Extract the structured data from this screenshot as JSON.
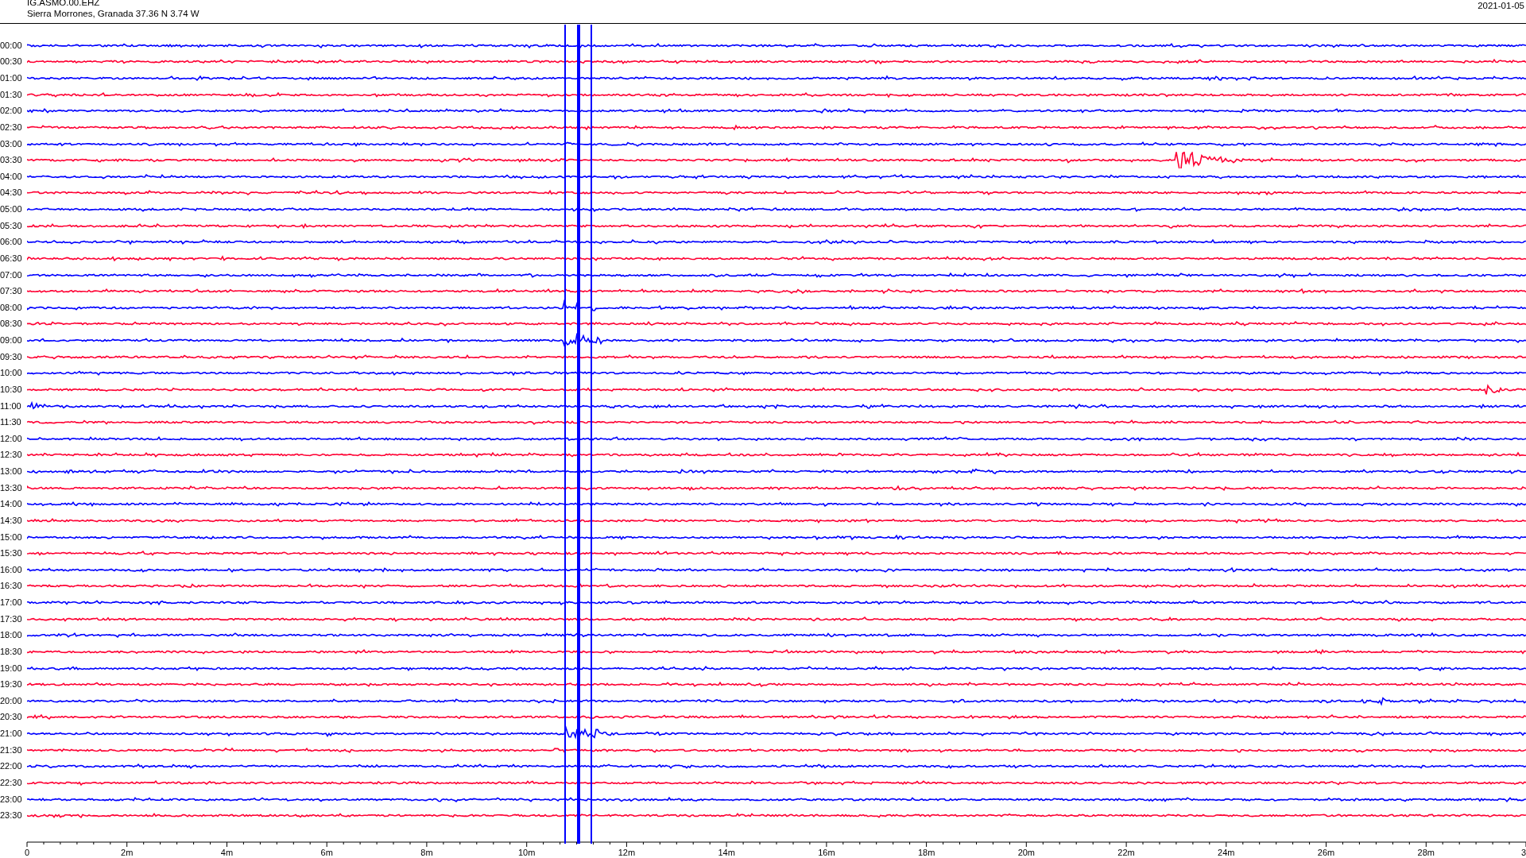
{
  "header": {
    "station": "IG.ASMO.00.EHZ",
    "location": "Sierra Morrones, Granada  37.36 N 3.74 W",
    "date": "2021-01-05"
  },
  "rows": [
    {
      "time": "00:00",
      "color": "#0000ff"
    },
    {
      "time": "00:30",
      "color": "#ff0033"
    },
    {
      "time": "01:00",
      "color": "#0000ff"
    },
    {
      "time": "01:30",
      "color": "#ff0033"
    },
    {
      "time": "02:00",
      "color": "#0000ff"
    },
    {
      "time": "02:30",
      "color": "#ff0033"
    },
    {
      "time": "03:00",
      "color": "#0000ff"
    },
    {
      "time": "03:30",
      "color": "#ff0033"
    },
    {
      "time": "04:00",
      "color": "#0000ff"
    },
    {
      "time": "04:30",
      "color": "#ff0033"
    },
    {
      "time": "05:00",
      "color": "#0000ff"
    },
    {
      "time": "05:30",
      "color": "#ff0033"
    },
    {
      "time": "06:00",
      "color": "#0000ff"
    },
    {
      "time": "06:30",
      "color": "#ff0033"
    },
    {
      "time": "07:00",
      "color": "#0000ff"
    },
    {
      "time": "07:30",
      "color": "#ff0033"
    },
    {
      "time": "08:00",
      "color": "#0000ff"
    },
    {
      "time": "08:30",
      "color": "#ff0033"
    },
    {
      "time": "09:00",
      "color": "#0000ff"
    },
    {
      "time": "09:30",
      "color": "#ff0033"
    },
    {
      "time": "10:00",
      "color": "#0000ff"
    },
    {
      "time": "10:30",
      "color": "#ff0033"
    },
    {
      "time": "11:00",
      "color": "#0000ff"
    },
    {
      "time": "11:30",
      "color": "#ff0033"
    },
    {
      "time": "12:00",
      "color": "#0000ff"
    },
    {
      "time": "12:30",
      "color": "#ff0033"
    },
    {
      "time": "13:00",
      "color": "#0000ff"
    },
    {
      "time": "13:30",
      "color": "#ff0033"
    },
    {
      "time": "14:00",
      "color": "#0000ff"
    },
    {
      "time": "14:30",
      "color": "#ff0033"
    },
    {
      "time": "15:00",
      "color": "#0000ff"
    },
    {
      "time": "15:30",
      "color": "#ff0033"
    },
    {
      "time": "16:00",
      "color": "#0000ff"
    },
    {
      "time": "16:30",
      "color": "#ff0033"
    },
    {
      "time": "17:00",
      "color": "#0000ff"
    },
    {
      "time": "17:30",
      "color": "#ff0033"
    },
    {
      "time": "18:00",
      "color": "#0000ff"
    },
    {
      "time": "18:30",
      "color": "#ff0033"
    },
    {
      "time": "19:00",
      "color": "#0000ff"
    },
    {
      "time": "19:30",
      "color": "#ff0033"
    },
    {
      "time": "20:00",
      "color": "#0000ff"
    },
    {
      "time": "20:30",
      "color": "#ff0033"
    },
    {
      "time": "21:00",
      "color": "#0000ff"
    },
    {
      "time": "21:30",
      "color": "#ff0033"
    },
    {
      "time": "22:00",
      "color": "#0000ff"
    },
    {
      "time": "22:30",
      "color": "#ff0033"
    },
    {
      "time": "23:00",
      "color": "#0000ff"
    },
    {
      "time": "23:30",
      "color": "#ff0033"
    }
  ],
  "x_axis": {
    "labels": [
      "0",
      "2m",
      "4m",
      "6m",
      "8m",
      "10m",
      "12m",
      "14m",
      "16m",
      "18m",
      "20m",
      "22m",
      "24m",
      "26m",
      "28m",
      "3"
    ]
  }
}
